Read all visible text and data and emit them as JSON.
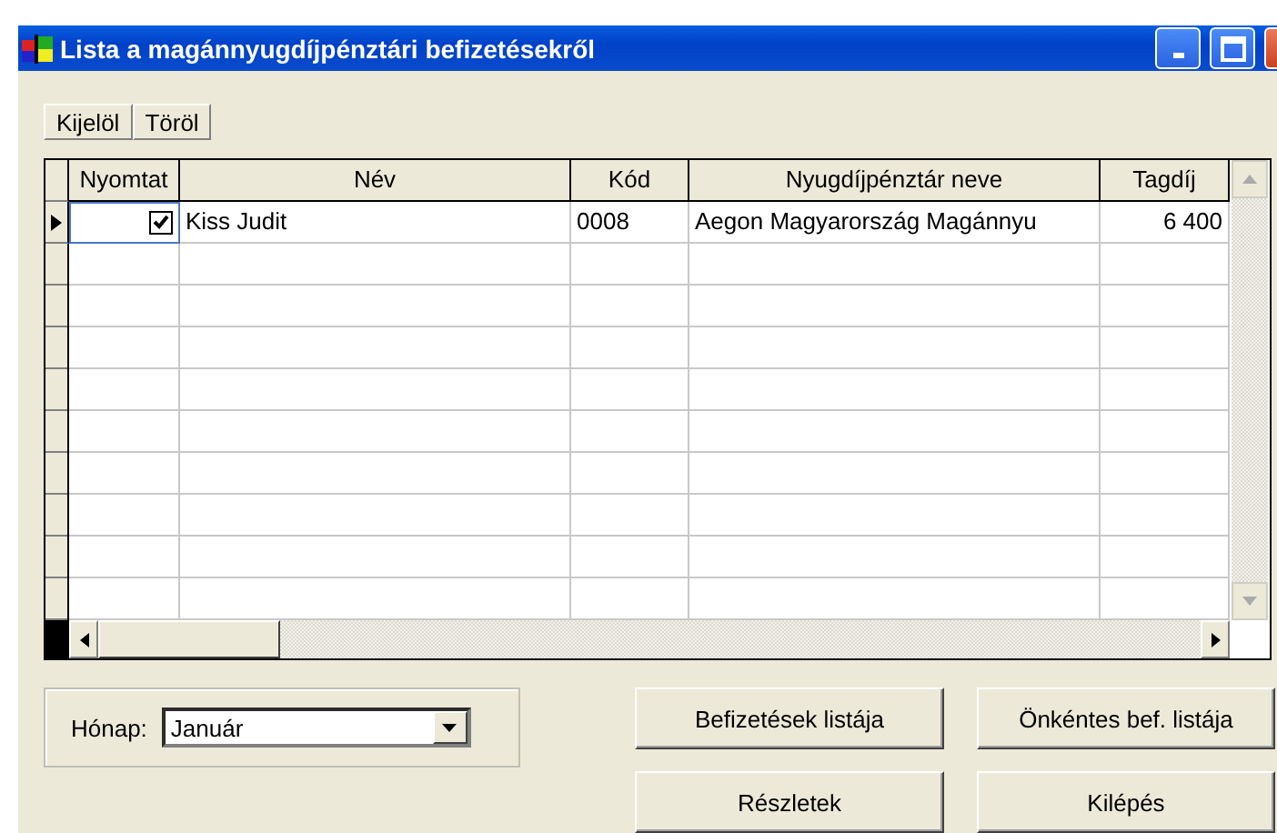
{
  "window": {
    "title": "Lista a magánnyugdíjpénztári befizetésekről"
  },
  "toolbar": [
    "Kijelöl",
    "Töröl"
  ],
  "table": {
    "columns": [
      "Nyomtat",
      "Név",
      "Kód",
      "Nyugdíjpénztár neve",
      "Tagdíj"
    ],
    "rows": [
      {
        "selected": true,
        "cells": [
          {
            "kind": "checkbox",
            "checked": true
          },
          {
            "kind": "text",
            "text": "Kiss Judit"
          },
          {
            "kind": "text",
            "text": "0008"
          },
          {
            "kind": "text",
            "text": "Aegon Magyarország Magánnyu"
          },
          {
            "kind": "number",
            "text": "6 400"
          }
        ]
      }
    ]
  },
  "month": {
    "label": "Hónap:",
    "value": "Január"
  },
  "buttons": [
    "Befizetések listája",
    "Önkéntes bef. listája",
    "Részletek",
    "Kilépés"
  ]
}
